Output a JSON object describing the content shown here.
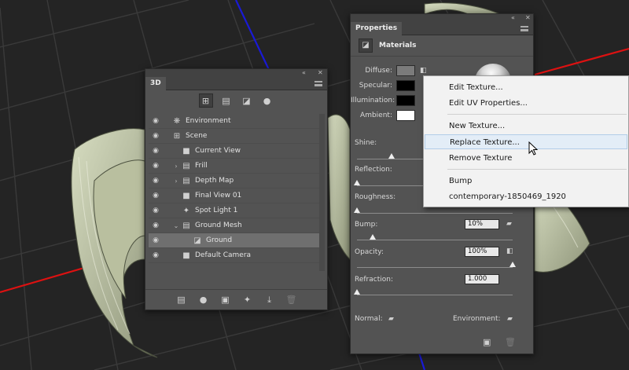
{
  "app": "Photoshop 3D workspace",
  "panel3d": {
    "tab": "3D",
    "tools": [
      {
        "icon": "scene-filter-icon",
        "glyph": "⊞",
        "active": true
      },
      {
        "icon": "mesh-filter-icon",
        "glyph": "▤",
        "active": false
      },
      {
        "icon": "material-filter-icon",
        "glyph": "◪",
        "active": false
      },
      {
        "icon": "light-filter-icon",
        "glyph": "●",
        "active": false
      }
    ],
    "tree": [
      {
        "label": "Environment",
        "icon": "environment-icon",
        "glyph": "❋",
        "indent": 0,
        "arrow": ""
      },
      {
        "label": "Scene",
        "icon": "scene-icon",
        "glyph": "⊞",
        "indent": 0,
        "arrow": ""
      },
      {
        "label": "Current View",
        "icon": "camera-icon",
        "glyph": "■",
        "indent": 1,
        "arrow": ""
      },
      {
        "label": "Frill",
        "icon": "mesh-icon",
        "glyph": "▤",
        "indent": 1,
        "arrow": "›"
      },
      {
        "label": "Depth Map",
        "icon": "mesh-icon",
        "glyph": "▤",
        "indent": 1,
        "arrow": "›"
      },
      {
        "label": "Final View 01",
        "icon": "camera-icon",
        "glyph": "■",
        "indent": 1,
        "arrow": ""
      },
      {
        "label": "Spot Light 1",
        "icon": "spot-light-icon",
        "glyph": "✦",
        "indent": 1,
        "arrow": ""
      },
      {
        "label": "Ground Mesh",
        "icon": "mesh-icon",
        "glyph": "▤",
        "indent": 1,
        "arrow": "⌄"
      },
      {
        "label": "Ground",
        "icon": "material-icon",
        "glyph": "◪",
        "indent": 2,
        "arrow": "",
        "selected": true
      },
      {
        "label": "Default Camera",
        "icon": "camera-icon",
        "glyph": "■",
        "indent": 1,
        "arrow": ""
      }
    ],
    "bottom_icons": [
      "mesh-icon",
      "light-bulb-icon",
      "render-icon",
      "add-light-icon",
      "drop-to-plane-icon",
      "trash-icon"
    ]
  },
  "properties": {
    "tab": "Properties",
    "section": "Materials",
    "swatches": [
      {
        "label": "Diffuse:",
        "color": "#7b7b7b"
      },
      {
        "label": "Specular:",
        "color": "#000000"
      },
      {
        "label": "Illumination:",
        "color": "#000000"
      },
      {
        "label": "Ambient:",
        "color": "#ffffff"
      }
    ],
    "shine": {
      "label": "Shine:",
      "level": 0.22
    },
    "reflection": {
      "label": "Reflection:",
      "level": 0.0
    },
    "roughness": {
      "label": "Roughness:",
      "level": 0.0
    },
    "bump": {
      "label": "Bump:",
      "value": "10%",
      "level": 0.1
    },
    "opacity": {
      "label": "Opacity:",
      "value": "100%",
      "level": 1.0
    },
    "refraction": {
      "label": "Refraction:",
      "value": "1.000",
      "level": 0.0
    },
    "normal_label": "Normal:",
    "environment_label": "Environment:"
  },
  "context_menu": {
    "items": [
      {
        "label": "Edit Texture..."
      },
      {
        "label": "Edit UV Properties..."
      },
      {
        "label": "New Texture..."
      },
      {
        "label": "Replace Texture...",
        "hover": true
      },
      {
        "label": "Remove Texture"
      },
      {
        "label": "Bump"
      },
      {
        "label": "contemporary-1850469_1920"
      }
    ]
  }
}
